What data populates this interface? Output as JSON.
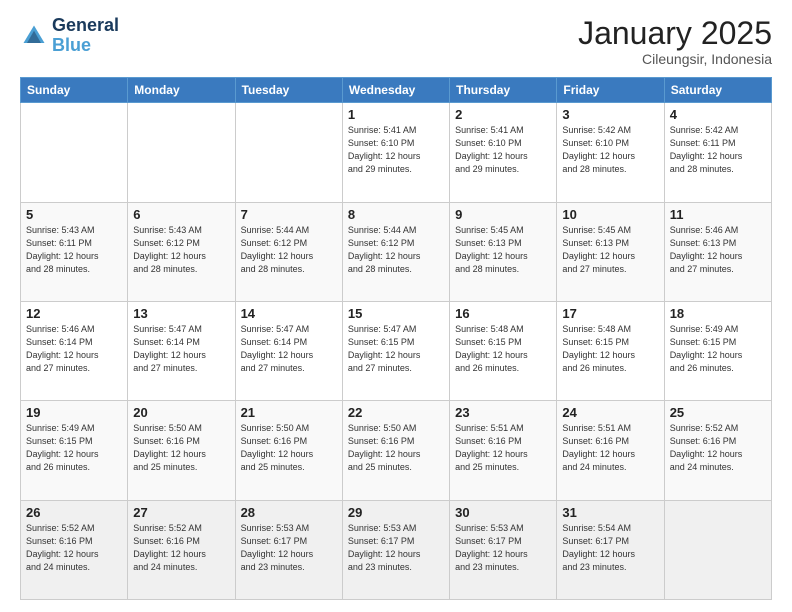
{
  "header": {
    "logo_line1": "General",
    "logo_line2": "Blue",
    "title": "January 2025",
    "subtitle": "Cileungsir, Indonesia"
  },
  "days_of_week": [
    "Sunday",
    "Monday",
    "Tuesday",
    "Wednesday",
    "Thursday",
    "Friday",
    "Saturday"
  ],
  "weeks": [
    [
      {
        "day": "",
        "info": ""
      },
      {
        "day": "",
        "info": ""
      },
      {
        "day": "",
        "info": ""
      },
      {
        "day": "1",
        "info": "Sunrise: 5:41 AM\nSunset: 6:10 PM\nDaylight: 12 hours\nand 29 minutes."
      },
      {
        "day": "2",
        "info": "Sunrise: 5:41 AM\nSunset: 6:10 PM\nDaylight: 12 hours\nand 29 minutes."
      },
      {
        "day": "3",
        "info": "Sunrise: 5:42 AM\nSunset: 6:10 PM\nDaylight: 12 hours\nand 28 minutes."
      },
      {
        "day": "4",
        "info": "Sunrise: 5:42 AM\nSunset: 6:11 PM\nDaylight: 12 hours\nand 28 minutes."
      }
    ],
    [
      {
        "day": "5",
        "info": "Sunrise: 5:43 AM\nSunset: 6:11 PM\nDaylight: 12 hours\nand 28 minutes."
      },
      {
        "day": "6",
        "info": "Sunrise: 5:43 AM\nSunset: 6:12 PM\nDaylight: 12 hours\nand 28 minutes."
      },
      {
        "day": "7",
        "info": "Sunrise: 5:44 AM\nSunset: 6:12 PM\nDaylight: 12 hours\nand 28 minutes."
      },
      {
        "day": "8",
        "info": "Sunrise: 5:44 AM\nSunset: 6:12 PM\nDaylight: 12 hours\nand 28 minutes."
      },
      {
        "day": "9",
        "info": "Sunrise: 5:45 AM\nSunset: 6:13 PM\nDaylight: 12 hours\nand 28 minutes."
      },
      {
        "day": "10",
        "info": "Sunrise: 5:45 AM\nSunset: 6:13 PM\nDaylight: 12 hours\nand 27 minutes."
      },
      {
        "day": "11",
        "info": "Sunrise: 5:46 AM\nSunset: 6:13 PM\nDaylight: 12 hours\nand 27 minutes."
      }
    ],
    [
      {
        "day": "12",
        "info": "Sunrise: 5:46 AM\nSunset: 6:14 PM\nDaylight: 12 hours\nand 27 minutes."
      },
      {
        "day": "13",
        "info": "Sunrise: 5:47 AM\nSunset: 6:14 PM\nDaylight: 12 hours\nand 27 minutes."
      },
      {
        "day": "14",
        "info": "Sunrise: 5:47 AM\nSunset: 6:14 PM\nDaylight: 12 hours\nand 27 minutes."
      },
      {
        "day": "15",
        "info": "Sunrise: 5:47 AM\nSunset: 6:15 PM\nDaylight: 12 hours\nand 27 minutes."
      },
      {
        "day": "16",
        "info": "Sunrise: 5:48 AM\nSunset: 6:15 PM\nDaylight: 12 hours\nand 26 minutes."
      },
      {
        "day": "17",
        "info": "Sunrise: 5:48 AM\nSunset: 6:15 PM\nDaylight: 12 hours\nand 26 minutes."
      },
      {
        "day": "18",
        "info": "Sunrise: 5:49 AM\nSunset: 6:15 PM\nDaylight: 12 hours\nand 26 minutes."
      }
    ],
    [
      {
        "day": "19",
        "info": "Sunrise: 5:49 AM\nSunset: 6:15 PM\nDaylight: 12 hours\nand 26 minutes."
      },
      {
        "day": "20",
        "info": "Sunrise: 5:50 AM\nSunset: 6:16 PM\nDaylight: 12 hours\nand 25 minutes."
      },
      {
        "day": "21",
        "info": "Sunrise: 5:50 AM\nSunset: 6:16 PM\nDaylight: 12 hours\nand 25 minutes."
      },
      {
        "day": "22",
        "info": "Sunrise: 5:50 AM\nSunset: 6:16 PM\nDaylight: 12 hours\nand 25 minutes."
      },
      {
        "day": "23",
        "info": "Sunrise: 5:51 AM\nSunset: 6:16 PM\nDaylight: 12 hours\nand 25 minutes."
      },
      {
        "day": "24",
        "info": "Sunrise: 5:51 AM\nSunset: 6:16 PM\nDaylight: 12 hours\nand 24 minutes."
      },
      {
        "day": "25",
        "info": "Sunrise: 5:52 AM\nSunset: 6:16 PM\nDaylight: 12 hours\nand 24 minutes."
      }
    ],
    [
      {
        "day": "26",
        "info": "Sunrise: 5:52 AM\nSunset: 6:16 PM\nDaylight: 12 hours\nand 24 minutes."
      },
      {
        "day": "27",
        "info": "Sunrise: 5:52 AM\nSunset: 6:16 PM\nDaylight: 12 hours\nand 24 minutes."
      },
      {
        "day": "28",
        "info": "Sunrise: 5:53 AM\nSunset: 6:17 PM\nDaylight: 12 hours\nand 23 minutes."
      },
      {
        "day": "29",
        "info": "Sunrise: 5:53 AM\nSunset: 6:17 PM\nDaylight: 12 hours\nand 23 minutes."
      },
      {
        "day": "30",
        "info": "Sunrise: 5:53 AM\nSunset: 6:17 PM\nDaylight: 12 hours\nand 23 minutes."
      },
      {
        "day": "31",
        "info": "Sunrise: 5:54 AM\nSunset: 6:17 PM\nDaylight: 12 hours\nand 23 minutes."
      },
      {
        "day": "",
        "info": ""
      }
    ]
  ]
}
